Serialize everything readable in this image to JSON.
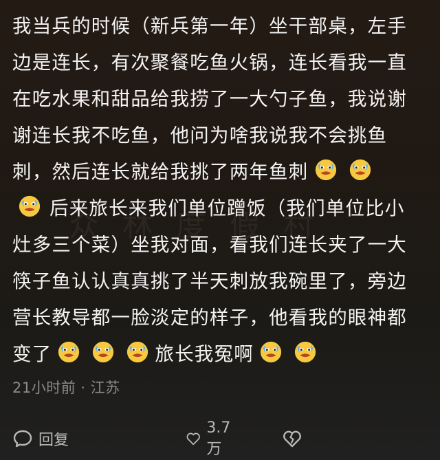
{
  "comment": {
    "lines": [
      "我当兵的时候（新兵第一年）坐干部桌，左手",
      "边是连长，有次聚餐吃鱼火锅，连长看我一直",
      "在吃水果和甜品给我捞了一大勺子鱼，我说谢",
      "谢连长我不吃鱼，他问为啥我说我不会挑鱼",
      "刺，然后连长就给我挑了两年鱼刺",
      "后来旅长来我们单位蹭饭（我们单位比小",
      "灶多三个菜）坐我对面，看我们连长夹了一大",
      "筷子鱼认认真真挑了半天刺放我碗里了，旁边",
      "营长教导都一脸淡定的样子，他看我的眼神都",
      "变了",
      "旅长我冤啊"
    ],
    "emoji_icon": "crying-laughing-face-icon"
  },
  "meta": {
    "time_location": "21小时前 · 江苏"
  },
  "actions": {
    "reply_label": "回复",
    "like_count": "3.7万"
  }
}
